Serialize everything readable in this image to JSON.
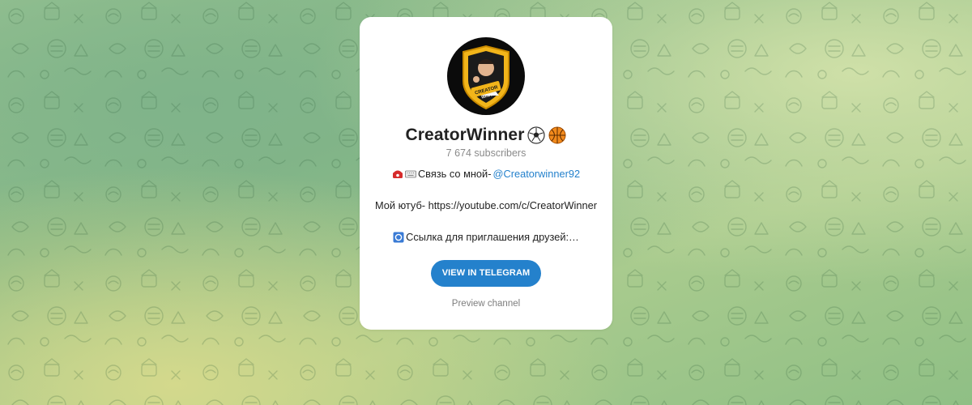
{
  "channel": {
    "name": "CreatorWinner",
    "subscribers": "7 674 subscribers",
    "avatar_text": "CREATOR WINNER"
  },
  "description": {
    "line1_text": "Связь со мной- ",
    "line1_link": "@Creatorwinner92",
    "line2_text": "Мой ютуб- https://youtube.com/c/CreatorWinner",
    "line3_text": "Ссылка для приглашения друзей:…"
  },
  "actions": {
    "view_button": "VIEW IN TELEGRAM",
    "preview_link": "Preview channel"
  },
  "icons": {
    "title_emoji_1": "soccer-ball-icon",
    "title_emoji_2": "basketball-icon",
    "line1_icon_1": "telephone-icon",
    "line1_icon_2": "keyboard-icon",
    "line3_icon": "link-icon"
  },
  "colors": {
    "accent": "#2481cc",
    "card_bg": "#ffffff",
    "title": "#222222",
    "muted": "#8a8a8a"
  }
}
